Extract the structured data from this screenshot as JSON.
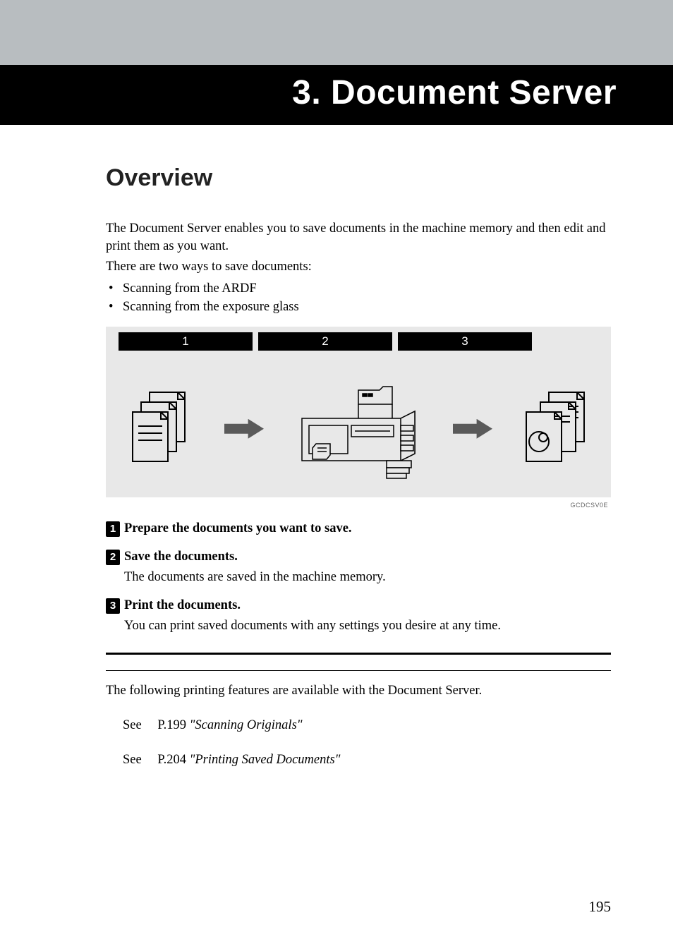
{
  "header": {
    "chapter_title": "3. Document Server"
  },
  "section": {
    "title": "Overview",
    "intro_1": "The Document Server enables you to save documents in the machine memory and then edit and print them as you want.",
    "intro_2": "There are two ways to save documents:",
    "bullets": [
      "Scanning from the ARDF",
      "Scanning from the exposure glass"
    ]
  },
  "diagram": {
    "headers": [
      "1",
      "2",
      "3"
    ],
    "code": "GCDCSV0E"
  },
  "steps": [
    {
      "num": "1",
      "title": "Prepare the documents you want to save.",
      "desc": ""
    },
    {
      "num": "2",
      "title": "Save the documents.",
      "desc": "The documents are saved in the machine memory."
    },
    {
      "num": "3",
      "title": "Print the documents.",
      "desc": "You can print saved documents with any settings you desire at any time."
    }
  ],
  "features_text": "The following printing features are available with the Document Server.",
  "refs": [
    {
      "see": "See",
      "page": "P.199",
      "title": "\"Scanning Originals\""
    },
    {
      "see": "See",
      "page": "P.204",
      "title": "\"Printing Saved Documents\""
    }
  ],
  "page_number": "195"
}
